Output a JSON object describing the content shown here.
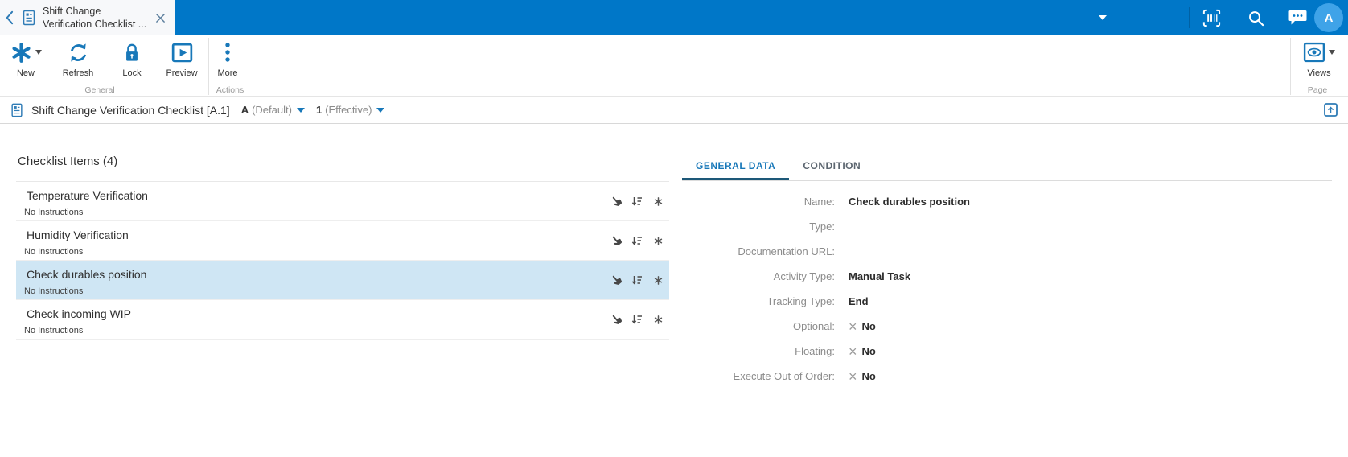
{
  "topbar": {
    "tab_title_line1": "Shift Change",
    "tab_title_line2": "Verification Checklist ...",
    "avatar_initial": "A"
  },
  "ribbon": {
    "new_label": "New",
    "refresh_label": "Refresh",
    "lock_label": "Lock",
    "preview_label": "Preview",
    "more_label": "More",
    "views_label": "Views",
    "group_general": "General",
    "group_actions": "Actions",
    "group_page": "Page"
  },
  "breadcrumb": {
    "title": "Shift Change Verification Checklist [A.1]",
    "version_value": "A",
    "version_qualifier": "(Default)",
    "revision_value": "1",
    "revision_qualifier": "(Effective)"
  },
  "checklist": {
    "header": "Checklist Items (4)",
    "items": [
      {
        "name": "Temperature Verification",
        "instructions": "No Instructions"
      },
      {
        "name": "Humidity Verification",
        "instructions": "No Instructions"
      },
      {
        "name": "Check durables position",
        "instructions": "No Instructions"
      },
      {
        "name": "Check incoming WIP",
        "instructions": "No Instructions"
      }
    ]
  },
  "details": {
    "tab_general": "GENERAL DATA",
    "tab_condition": "CONDITION",
    "x_glyph": "×",
    "fields": [
      {
        "label": "Name:",
        "value": "Check durables position"
      },
      {
        "label": "Type:",
        "value": ""
      },
      {
        "label": "Documentation URL:",
        "value": ""
      },
      {
        "label": "Activity Type:",
        "value": "Manual Task"
      },
      {
        "label": "Tracking Type:",
        "value": "End"
      },
      {
        "label": "Optional:",
        "value": "No"
      },
      {
        "label": "Floating:",
        "value": "No"
      },
      {
        "label": "Execute Out of Order:",
        "value": "No"
      }
    ]
  },
  "colors": {
    "topbar_blue": "#0077c8",
    "icon_blue": "#1878b9",
    "active_tab_underline": "#1d5878",
    "selected_row_bg": "#cfe6f4",
    "avatar_blue": "#3fa3e8"
  }
}
